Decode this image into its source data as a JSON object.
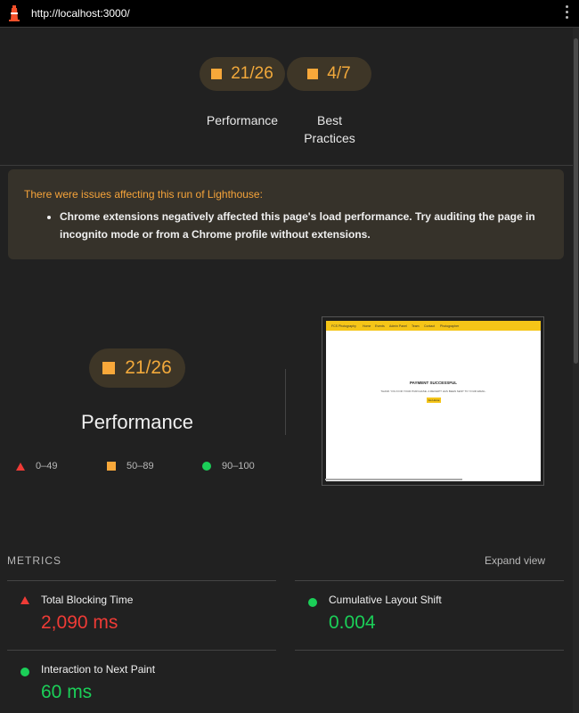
{
  "browser": {
    "url": "http://localhost:3000/",
    "icons": [
      "lighthouse-icon",
      "more-vertical-icon"
    ]
  },
  "summary": {
    "categories": [
      {
        "score": "21/26",
        "label_line1": "Performance",
        "label_line2": ""
      },
      {
        "score": "4/7",
        "label_line1": "Best",
        "label_line2": "Practices"
      }
    ]
  },
  "warning": {
    "title": "There were issues affecting this run of Lighthouse:",
    "items": [
      "Chrome extensions negatively affected this page's load performance. Try auditing the page in incognito mode or from a Chrome profile without extensions."
    ]
  },
  "performance": {
    "score": "21/26",
    "title": "Performance",
    "legend": [
      {
        "icon": "fail-triangle-icon",
        "range": "0–49"
      },
      {
        "icon": "average-square-icon",
        "range": "50–89"
      },
      {
        "icon": "pass-circle-icon",
        "range": "90–100"
      }
    ],
    "screenshot": {
      "nav_brand": "FCS Photography",
      "nav_items": [
        "Home",
        "Events",
        "Admin Panel",
        "Team",
        "Contact",
        "Photographer"
      ],
      "heading": "PAYMENT SUCCESSFUL",
      "subtext": "THANK YOU FOR YOUR PURCHASE. A RECEIPT HAS BEEN SENT TO YOUR EMAIL.",
      "button": "Go Home"
    }
  },
  "metrics": {
    "title": "METRICS",
    "expand_label": "Expand view",
    "items": [
      {
        "name": "Total Blocking Time",
        "value": "2,090 ms",
        "status": "fail"
      },
      {
        "name": "Cumulative Layout Shift",
        "value": "0.004",
        "status": "pass"
      },
      {
        "name": "Interaction to Next Paint",
        "value": "60 ms",
        "status": "pass"
      }
    ]
  },
  "colors": {
    "fail": "#ef3b36",
    "average": "#f8a83a",
    "pass": "#1bcf58",
    "background": "#212121"
  }
}
